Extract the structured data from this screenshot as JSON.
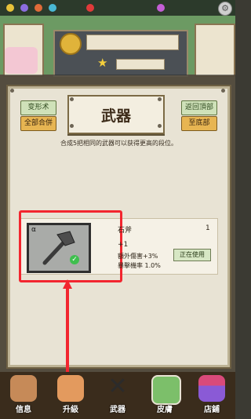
{
  "panel": {
    "title": "武器",
    "left_buttons": [
      "变形术",
      "全部合併"
    ],
    "right_buttons": [
      "返回頂部",
      "至底部"
    ],
    "hint": "合成5把相同的武器可以获得更高的段位。"
  },
  "weapon": {
    "rank": "α",
    "name": "石斧",
    "count": "1",
    "level": "+1",
    "stat1": "額外傷害+3%",
    "stat2": "暴擊機率 1.0%",
    "status_button": "正在使用",
    "icon": "stone-axe-icon"
  },
  "nav": [
    {
      "label": "信息",
      "icon": "merchant-icon"
    },
    {
      "label": "升級",
      "icon": "muscle-icon"
    },
    {
      "label": "武器",
      "icon": "crossed-swords-icon"
    },
    {
      "label": "皮膚",
      "icon": "landscape-icon"
    },
    {
      "label": "店鋪",
      "icon": "shop-icon"
    }
  ],
  "colors": {
    "highlight": "#f2262f",
    "button_gold": "#e7b552",
    "button_green": "#cfe1b9"
  }
}
